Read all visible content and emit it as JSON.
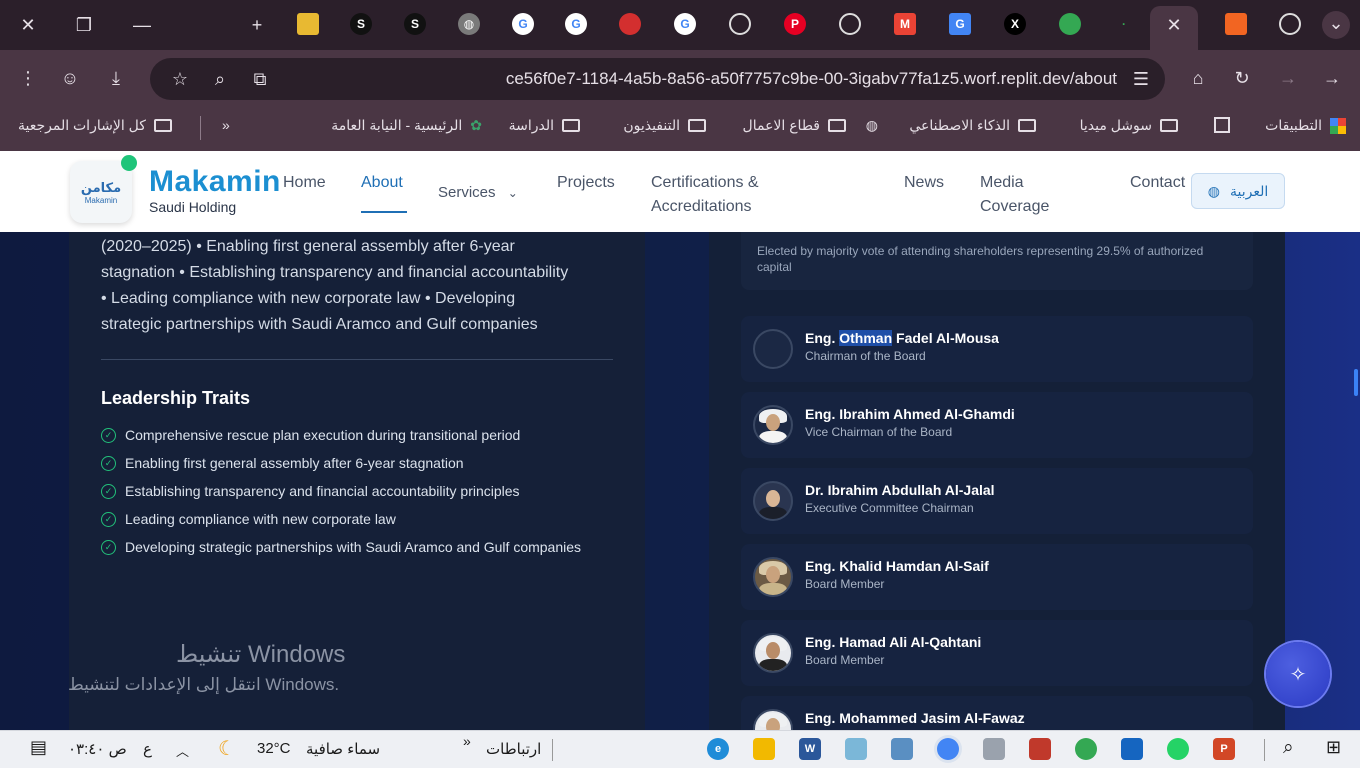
{
  "browser": {
    "url": "ce56f0e7-1184-4a5b-8a56-a50f7757c9be-00-3igabv77fa1z5.worf.replit.dev/about",
    "bookmarks": [
      {
        "label": "التطبيقات"
      },
      {
        "label": "سوشل ميديا"
      },
      {
        "label": "الذكاء الاصطناعي"
      },
      {
        "label": "قطاع الاعمال"
      },
      {
        "label": "التنفيذيون"
      },
      {
        "label": "الدراسة"
      },
      {
        "label": "الرئيسية - النيابة العامة"
      },
      {
        "label": "كل الإشارات المرجعية"
      }
    ],
    "more_bookmarks": "»"
  },
  "header": {
    "logo_text": "مكامن",
    "logo_sub": "Makamin",
    "brand": "Makamin",
    "brand_sub": "Saudi Holding",
    "nav": {
      "home": "Home",
      "about": "About",
      "services": "Services",
      "projects": "Projects",
      "cert_line1": "Certifications &",
      "cert_line2": "Accreditations",
      "news": "News",
      "media_line1": "Media",
      "media_line2": "Coverage",
      "contact": "Contact"
    },
    "language_button": "العربية"
  },
  "left_card": {
    "bio_line1": "(2020–2025) • Enabling first general assembly after 6-year",
    "bio_line2": "stagnation • Establishing transparency and financial accountability",
    "bio_line3": "• Leading compliance with new corporate law • Developing",
    "bio_line4": "strategic partnerships with Saudi Aramco and Gulf companies",
    "traits_title": "Leadership Traits",
    "traits": [
      "Comprehensive rescue plan execution during transitional period",
      "Enabling first general assembly after 6-year stagnation",
      "Establishing transparency and financial accountability principles",
      "Leading compliance with new corporate law",
      "Developing strategic partnerships with Saudi Aramco and Gulf companies"
    ]
  },
  "right_card": {
    "vote_note": "Elected by majority vote of attending shareholders representing 29.5% of authorized capital",
    "members": [
      {
        "prefix": "Eng. ",
        "highlight": "Othman",
        "rest": " Fadel Al-Mousa",
        "role": "Chairman of the Board"
      },
      {
        "prefix": "Eng. Ibrahim Ahmed Al-Ghamdi",
        "highlight": "",
        "rest": "",
        "role": "Vice Chairman of the Board"
      },
      {
        "prefix": "Dr. Ibrahim Abdullah Al-Jalal",
        "highlight": "",
        "rest": "",
        "role": "Executive Committee Chairman"
      },
      {
        "prefix": "Eng. Khalid Hamdan Al-Saif",
        "highlight": "",
        "rest": "",
        "role": "Board Member"
      },
      {
        "prefix": "Eng. Hamad Ali Al-Qahtani",
        "highlight": "",
        "rest": "",
        "role": "Board Member"
      },
      {
        "prefix": "Eng. Mohammed Jasim Al-Fawaz",
        "highlight": "",
        "rest": "",
        "role": ""
      }
    ]
  },
  "watermark": {
    "line1": "تنشيط Windows",
    "line2": "انتقل إلى الإعدادات لتنشيط Windows."
  },
  "taskbar": {
    "time": "۰۳:٤۰ ص",
    "lang": "ع",
    "temperature": "32°C",
    "weather": "سماء صافية",
    "links": "ارتباطات"
  }
}
